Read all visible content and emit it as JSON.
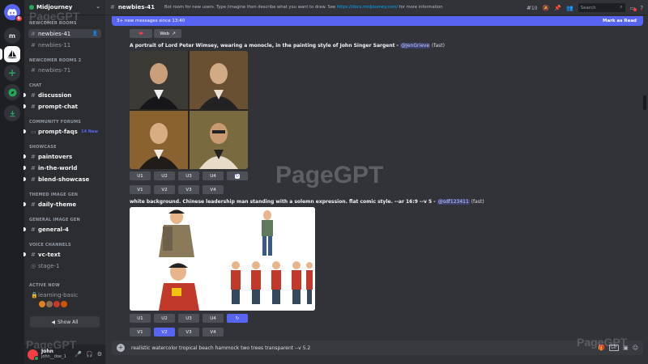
{
  "server": {
    "name": "Midjourney"
  },
  "rail": {
    "discord_badge": "6",
    "server_m": "m"
  },
  "sidebar": {
    "categories": {
      "newcomer1": "NEWCOMER ROOMS",
      "newcomer2": "NEWCOMER ROOMS 2",
      "chat": "CHAT",
      "forums": "COMMUNITY FORUMS",
      "showcase": "SHOWCASE",
      "themed": "THEMED IMAGE GEN",
      "general": "GENERAL IMAGE GEN",
      "voice": "VOICE CHANNELS",
      "active": "ACTIVE NOW"
    },
    "channels": {
      "newbies41": "newbies-41",
      "newbies11": "newbies-11",
      "newbies71": "newbies-71",
      "discussion": "discussion",
      "promptchat": "prompt-chat",
      "promptfaqs": "prompt-faqs",
      "promptfaqs_new": "14 New",
      "paintovers": "paintovers",
      "intheworld": "in-the-world",
      "blendshowcase": "blend-showcase",
      "dailytheme": "daily-theme",
      "general4": "general-4",
      "vctext": "vc-text",
      "stage1": "stage-1",
      "learningbasic": "learning-basic"
    },
    "show_all": "Show All"
  },
  "user": {
    "display": "John",
    "handle": "john__doe_1"
  },
  "topbar": {
    "channel": "newbies-41",
    "topic_prefix": "Bot room for new users. Type /imagine then describe what you want to draw. See ",
    "topic_link": "https://docs.midjourney.com/",
    "topic_suffix": " for more information",
    "threads_count": "10",
    "search_placeholder": "Search"
  },
  "banner": {
    "text": "3+ new messages since 13:40",
    "mark_read": "Mark as Read"
  },
  "messages": [
    {
      "web_label": "Web",
      "prompt": "A portrait of Lord Peter Wimsey, wearing a monocle, in the painting style of John Singer Sargent - ",
      "mention": "@JenGrieve",
      "speed": " (fast)",
      "upscale": [
        "U1",
        "U2",
        "U3",
        "U4"
      ],
      "variation": [
        "V1",
        "V2",
        "V3",
        "V4"
      ]
    },
    {
      "prompt": "white background. Chinese leadership man standing with a solemn expression. flat comic style. --ar 16:9 --v 5 - ",
      "mention": "@sdf123411",
      "speed": " (fast)",
      "upscale": [
        "U1",
        "U2",
        "U3",
        "U4"
      ],
      "variation": [
        "V1",
        "V2",
        "V3",
        "V4"
      ],
      "selected_variation": "V2"
    }
  ],
  "input": {
    "value": "realistic watercolor tropical beach hammock two trees transparent --v 5.2"
  },
  "watermarks": [
    "PageGPT",
    "PageGPT",
    "PageGPT",
    "PageGPT"
  ],
  "colors": {
    "blurple": "#5865f2",
    "sidebar": "#2b2d31",
    "chat": "#313338",
    "rail": "#1e1f22"
  }
}
